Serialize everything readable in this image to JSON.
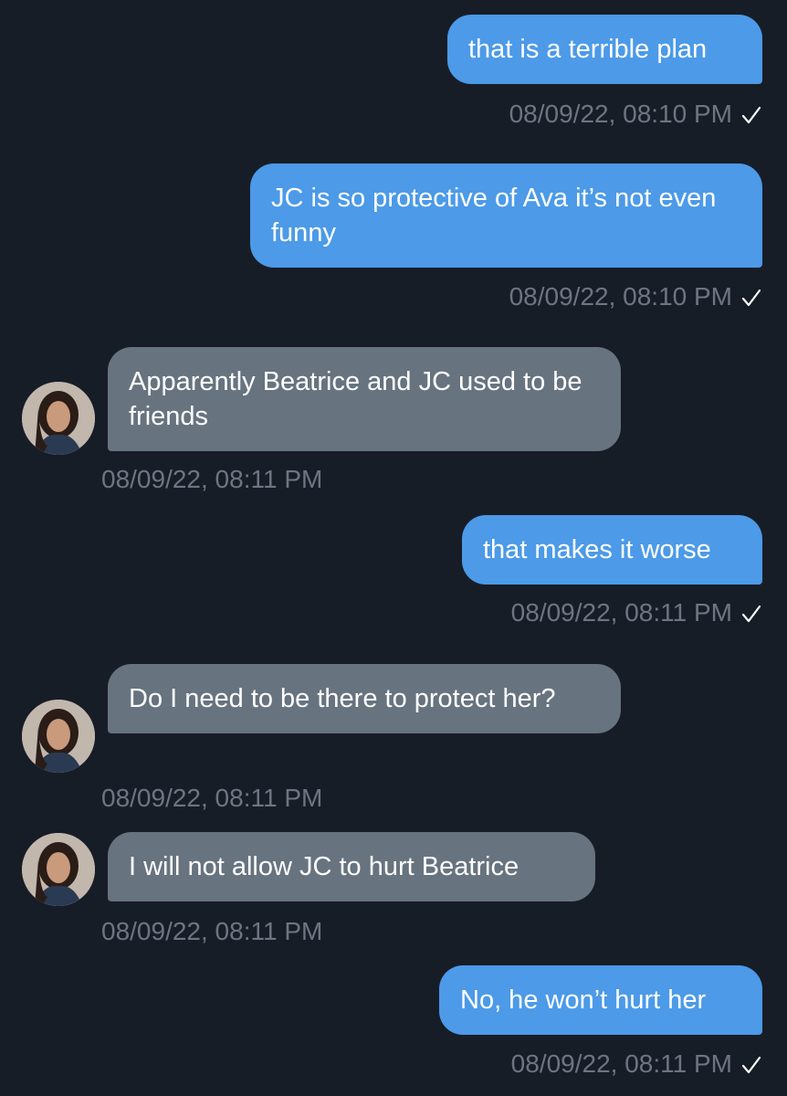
{
  "colors": {
    "background": "#171d27",
    "outgoing_bubble": "#4c9ae8",
    "incoming_bubble": "#67737f",
    "timestamp": "#6c7682",
    "read_check": "#ffffff"
  },
  "messages": [
    {
      "direction": "outgoing",
      "text": "that is a terrible plan",
      "timestamp": "08/09/22, 08:10 PM",
      "read_icon": "checkmark-icon"
    },
    {
      "direction": "outgoing",
      "text": "JC is so protective of Ava it’s not even funny",
      "timestamp": "08/09/22, 08:10 PM",
      "read_icon": "checkmark-icon"
    },
    {
      "direction": "incoming",
      "text": "Apparently Beatrice and JC used to be friends",
      "timestamp": "08/09/22, 08:11 PM",
      "avatar_icon": "contact-avatar"
    },
    {
      "direction": "outgoing",
      "text": "that makes it worse",
      "timestamp": "08/09/22, 08:11 PM",
      "read_icon": "checkmark-icon"
    },
    {
      "direction": "incoming",
      "text": "Do I need to be there to protect her?",
      "timestamp": "08/09/22, 08:11 PM",
      "avatar_icon": "contact-avatar"
    },
    {
      "direction": "incoming",
      "text": "I will not allow JC to hurt Beatrice",
      "timestamp": "08/09/22, 08:11 PM",
      "avatar_icon": "contact-avatar"
    },
    {
      "direction": "outgoing",
      "text": "No, he won’t hurt her",
      "timestamp": "08/09/22, 08:11 PM",
      "read_icon": "checkmark-icon"
    }
  ]
}
